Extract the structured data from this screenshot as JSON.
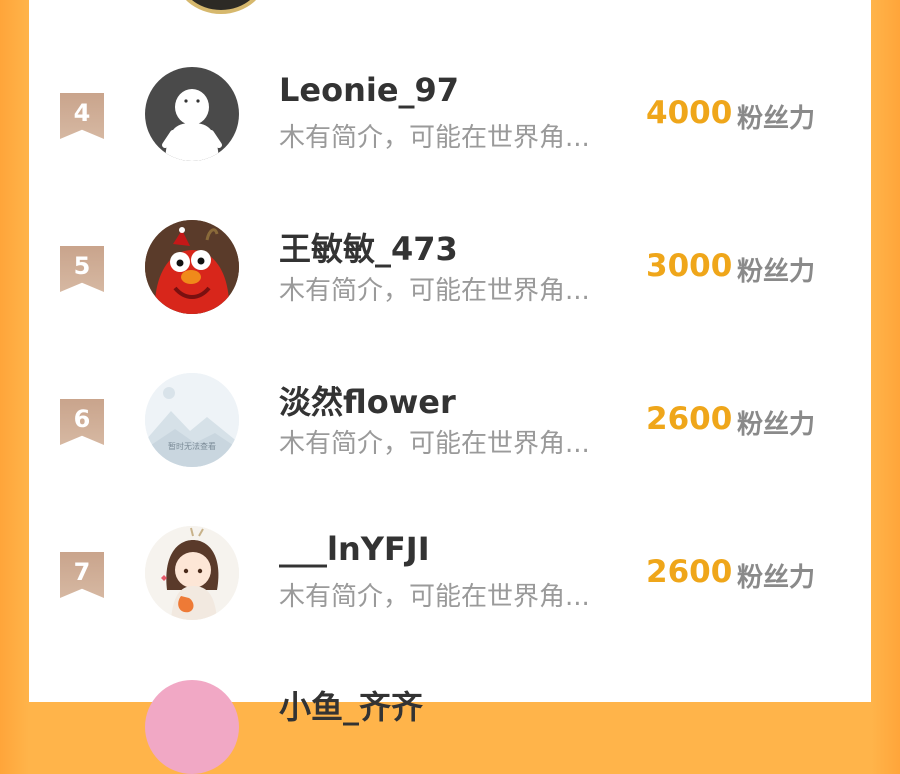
{
  "fans_label": "粉丝力",
  "rows": [
    {
      "rank": "4",
      "name": "Leonie_97",
      "bio": "木有简介，可能在世界角...",
      "fans": "4000"
    },
    {
      "rank": "5",
      "name": "王敏敏_473",
      "bio": "木有简介，可能在世界角...",
      "fans": "3000"
    },
    {
      "rank": "6",
      "name": "淡然flower",
      "bio": "木有简介，可能在世界角...",
      "fans": "2600"
    },
    {
      "rank": "7",
      "name": "___lnYFJI",
      "bio": "木有简介，可能在世界角...",
      "fans": "2600"
    }
  ],
  "avatar_placeholder_text": "暂时无法查看",
  "cut_row_name": "小鱼_齐齐"
}
